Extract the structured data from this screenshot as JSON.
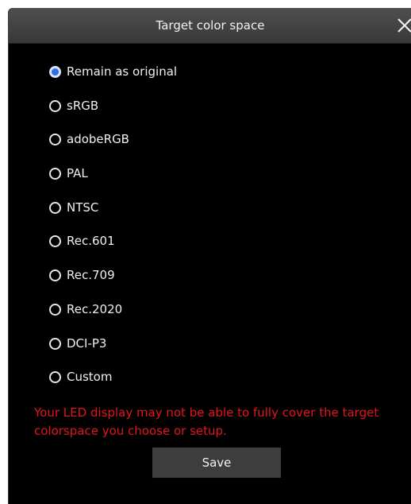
{
  "dialog": {
    "title": "Target color space",
    "close_icon": "close-icon"
  },
  "options": [
    {
      "label": "Remain as original",
      "selected": true
    },
    {
      "label": "sRGB",
      "selected": false
    },
    {
      "label": "adobeRGB",
      "selected": false
    },
    {
      "label": "PAL",
      "selected": false
    },
    {
      "label": "NTSC",
      "selected": false
    },
    {
      "label": "Rec.601",
      "selected": false
    },
    {
      "label": "Rec.709",
      "selected": false
    },
    {
      "label": "Rec.2020",
      "selected": false
    },
    {
      "label": "DCI-P3",
      "selected": false
    },
    {
      "label": "Custom",
      "selected": false
    }
  ],
  "warning": "Your LED display may not be able to fully cover the target colorspace you choose or setup.",
  "save_label": "Save",
  "colors": {
    "background": "#000000",
    "accent": "#2f6fe0",
    "warning": "#e3141c",
    "button": "#3d3d3d"
  }
}
